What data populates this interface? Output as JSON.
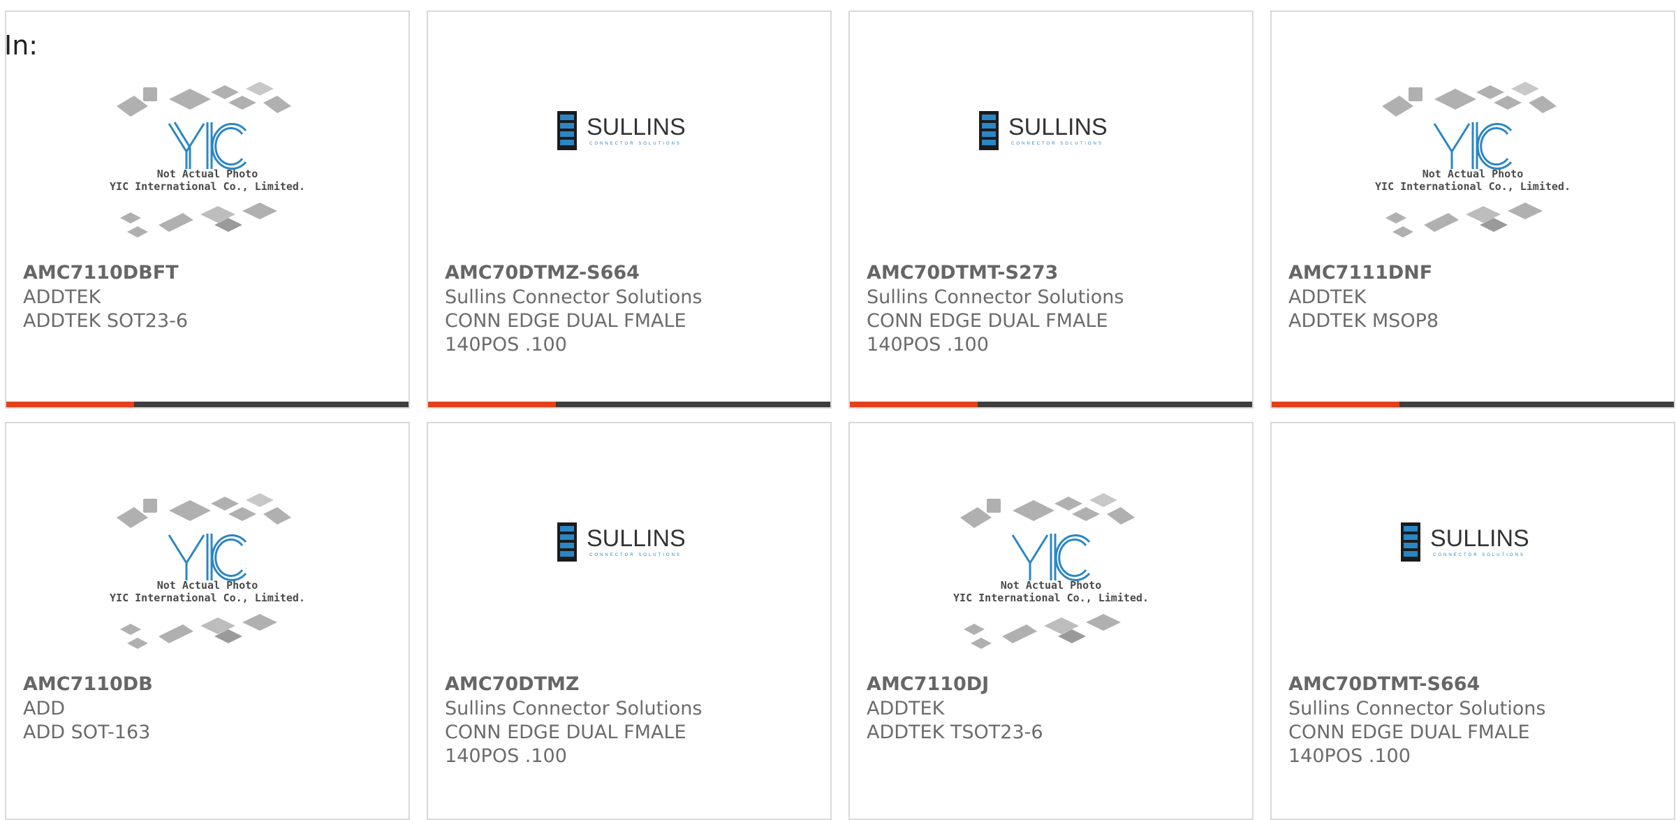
{
  "header": {
    "label": "In:"
  },
  "logos": {
    "yic_caption_line1": "Not Actual Photo",
    "yic_caption_line2": "YIC International Co., Limited.",
    "sullins_name": "SULLINS",
    "sullins_tagline": "CONNECTOR SOLUTIONS"
  },
  "colors": {
    "accent": "#e3401c",
    "bar": "#3d3d3d",
    "yic_blue": "#2a86c4",
    "sullins_blue": "#1f6fb0"
  },
  "products": [
    {
      "part": "AMC7110DBFT",
      "mfr": "ADDTEK",
      "desc": "ADDTEK SOT23-6",
      "image": "yic-placeholder"
    },
    {
      "part": "AMC70DTMZ-S664",
      "mfr": "Sullins Connector Solutions",
      "desc": "CONN EDGE DUAL FMALE\n140POS .100",
      "image": "sullins-logo"
    },
    {
      "part": "AMC70DTMT-S273",
      "mfr": "Sullins Connector Solutions",
      "desc": "CONN EDGE DUAL FMALE\n140POS .100",
      "image": "sullins-logo"
    },
    {
      "part": "AMC7111DNF",
      "mfr": "ADDTEK",
      "desc": "ADDTEK MSOP8",
      "image": "yic-placeholder"
    },
    {
      "part": "AMC7110DB",
      "mfr": "ADD",
      "desc": "ADD SOT-163",
      "image": "yic-placeholder"
    },
    {
      "part": "AMC70DTMZ",
      "mfr": "Sullins Connector Solutions",
      "desc": "CONN EDGE DUAL FMALE\n140POS .100",
      "image": "sullins-logo"
    },
    {
      "part": "AMC7110DJ",
      "mfr": "ADDTEK",
      "desc": "ADDTEK TSOT23-6",
      "image": "yic-placeholder"
    },
    {
      "part": "AMC70DTMT-S664",
      "mfr": "Sullins Connector Solutions",
      "desc": "CONN EDGE DUAL FMALE\n140POS .100",
      "image": "sullins-logo"
    }
  ]
}
